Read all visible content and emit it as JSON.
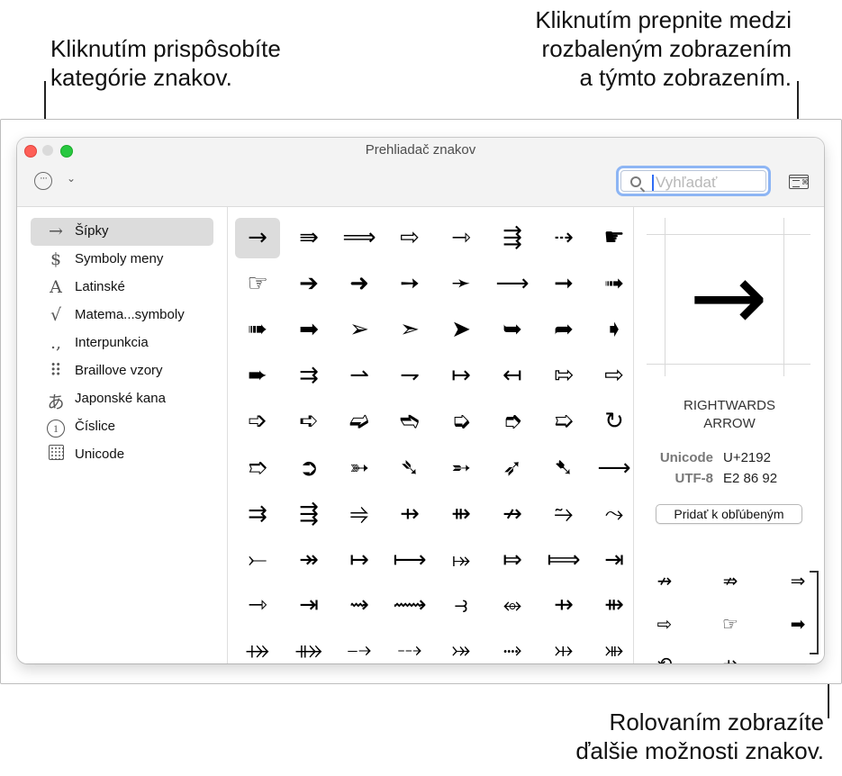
{
  "callouts": {
    "categories": "Kliknutím prispôsobíte\nkategórie znakov.",
    "toggle_view": "Kliknutím prepnite medzi\nrozbaleným zobrazením\na týmto zobrazením.",
    "scroll": "Rolovaním zobrazíte\nďalšie možnosti znakov."
  },
  "window": {
    "title": "Prehliadač znakov",
    "search_placeholder": "Vyhľadať",
    "category_menu_glyph": "···",
    "chevron_glyph": "⌄"
  },
  "sidebar": {
    "items": [
      {
        "icon": "→",
        "label": "Šípky",
        "selected": true
      },
      {
        "icon": "$",
        "label": "Symboly meny"
      },
      {
        "icon": "A",
        "label": "Latinské"
      },
      {
        "icon": "√",
        "label": "Matema...symboly"
      },
      {
        "icon": ".,",
        "label": "Interpunkcia"
      },
      {
        "icon": "⠿",
        "label": "Braillove vzory"
      },
      {
        "icon": "あ",
        "label": "Japonské kana"
      },
      {
        "icon": "1",
        "label": "Číslice"
      },
      {
        "icon": "",
        "label": "Unicode"
      }
    ]
  },
  "grid": {
    "rows": [
      [
        "→",
        "⇛",
        "⟹",
        "⇨",
        "⇾",
        "⇶",
        "⇢",
        "☛"
      ],
      [
        "☞",
        "➔",
        "➜",
        "➙",
        "➛",
        "⟶",
        "➞",
        "➟"
      ],
      [
        "➠",
        "➡",
        "➢",
        "➣",
        "➤",
        "➥",
        "➦",
        "➧"
      ],
      [
        "➨",
        "⇉",
        "⇀",
        "⇁",
        "↦",
        "↤",
        "⇰",
        "⇨"
      ],
      [
        "➩",
        "➪",
        "➫",
        "➬",
        "➭",
        "➮",
        "➯",
        "↻"
      ],
      [
        "➱",
        "➲",
        "➳",
        "➴",
        "➵",
        "➶",
        "➷",
        "⟶"
      ],
      [
        "⇉",
        "⇶",
        "⥤",
        "⇸",
        "⇻",
        "↛",
        "⥲",
        "⤳"
      ],
      [
        "⤚",
        "↠",
        "↦",
        "⟼",
        "⤅",
        "⤇",
        "⟾",
        "⇥"
      ],
      [
        "⇾",
        "⇥",
        "⇝",
        "⟿",
        "⥽",
        "⥈",
        "⇸",
        "⇻"
      ],
      [
        "⤀",
        "⤁",
        "⤍",
        "⤏",
        "⤖",
        "⤑",
        "⤔",
        "⤕"
      ]
    ]
  },
  "detail": {
    "glyph": "→",
    "name": "RIGHTWARDS\nARROW",
    "unicode_label": "Unicode",
    "unicode_value": "U+2192",
    "utf8_label": "UTF-8",
    "utf8_value": "E2 86 92",
    "favorite_button": "Pridať k obľúbeným",
    "variants": [
      "↛",
      "⇏",
      "⇒",
      "⇨",
      "☞",
      "➡",
      "⟲",
      "⇸"
    ]
  }
}
